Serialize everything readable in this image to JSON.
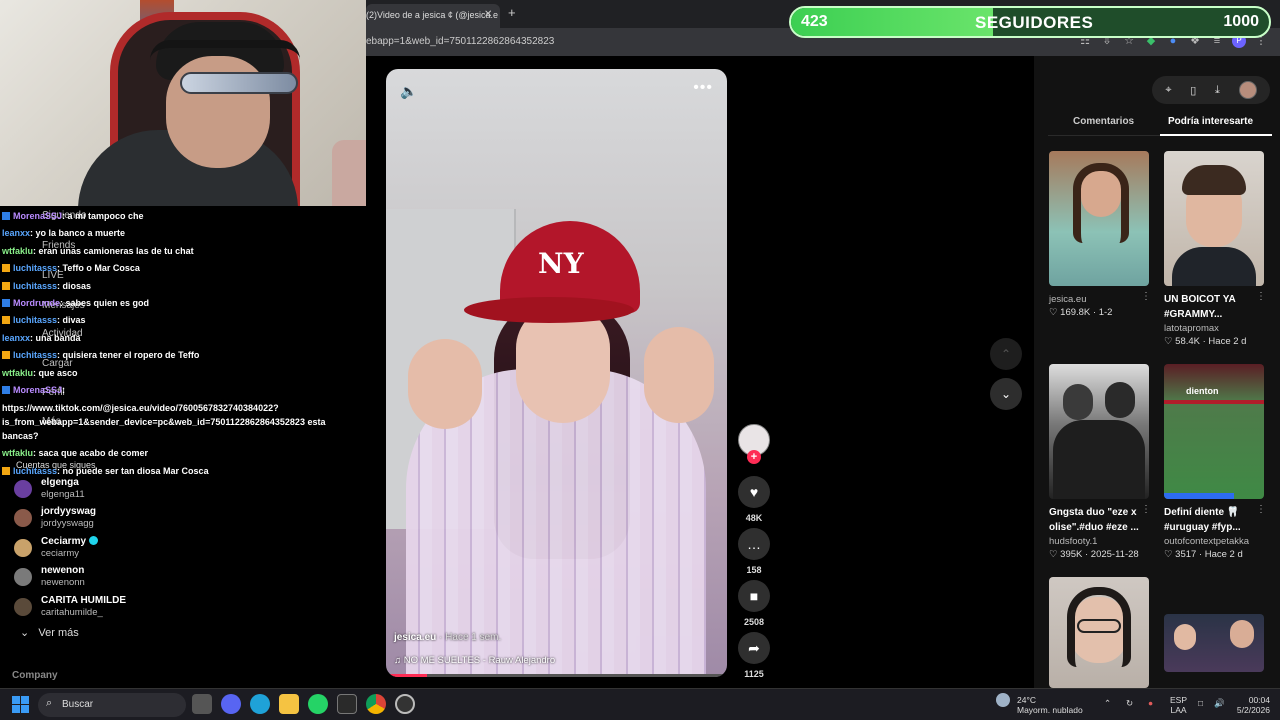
{
  "browser": {
    "tab_title": "(2)Video de a jesica ¢ (@jesica.e",
    "tab_close": "✕",
    "tab_new": "+",
    "url": "ebapp=1&web_id=7501122862864352823"
  },
  "goal": {
    "current": "423",
    "title": "SEGUIDORES",
    "target": "1000",
    "progress_fraction": 0.423
  },
  "chat": [
    {
      "user": "MorenaSSJ",
      "badge": "blue",
      "color": "purple",
      "msg": ": a mi tampoco che"
    },
    {
      "user": "leanxx",
      "badge": "",
      "color": "blue",
      "msg": ": yo la banco a muerte"
    },
    {
      "user": "wtfaklu",
      "badge": "",
      "color": "green",
      "msg": ": eran unas camioneras las de tu chat"
    },
    {
      "user": "luchitasss",
      "badge": "gold",
      "color": "blue",
      "msg": ": Teffo o Mar Cosca"
    },
    {
      "user": "luchitasss",
      "badge": "gold",
      "color": "blue",
      "msg": ": diosas"
    },
    {
      "user": "Mordrunde",
      "badge": "blue",
      "color": "purple",
      "msg": ": sabes quien es god"
    },
    {
      "user": "luchitasss",
      "badge": "gold",
      "color": "blue",
      "msg": ": divas"
    },
    {
      "user": "leanxx",
      "badge": "",
      "color": "blue",
      "msg": ": una banda"
    },
    {
      "user": "luchitasss",
      "badge": "gold",
      "color": "blue",
      "msg": ": quisiera tener el ropero de Teffo"
    },
    {
      "user": "wtfaklu",
      "badge": "",
      "color": "green",
      "msg": ": que asco"
    },
    {
      "user": "MorenaSSJ",
      "badge": "blue",
      "color": "purple",
      "msg": ":"
    },
    {
      "user": "",
      "badge": "",
      "color": "blue",
      "msg": "https://www.tiktok.com/@jesica.eu/video/7600567832740384022?is_from_webapp=1&sender_device=pc&web_id=7501122862864352823 esta bancas?",
      "wrap": true
    },
    {
      "user": "wtfaklu",
      "badge": "",
      "color": "green",
      "msg": ": saca que acabo de comer"
    },
    {
      "user": "luchitasss",
      "badge": "gold",
      "color": "blue",
      "msg": ": no puede ser tan diosa Mar Cosca"
    }
  ],
  "sidebar_ghost": {
    "following": "Siguiendo",
    "friends": "Friends",
    "live": "LIVE",
    "messages": "Mensajes",
    "activity": "Actividad",
    "upload": "Cargar",
    "profile": "Perfil",
    "more": "Más",
    "accounts_title": "Cuentas que sigues"
  },
  "following": [
    {
      "name": "elgenga",
      "handle": "elgenga11",
      "verified": false,
      "color": "#6a3fa0"
    },
    {
      "name": "jordyyswag",
      "handle": "jordyyswagg",
      "verified": false,
      "color": "#8a5a4a"
    },
    {
      "name": "Ceciarmy",
      "handle": "ceciarmy",
      "verified": true,
      "color": "#c9a26a"
    },
    {
      "name": "newenon",
      "handle": "newenonn",
      "verified": false,
      "color": "#7a7a7a"
    },
    {
      "name": "CARITA HUMILDE",
      "handle": "caritahumilde_",
      "verified": false,
      "color": "#5a4a3a"
    }
  ],
  "see_more": "Ver más",
  "company": "Company",
  "video": {
    "author": "jesica.eu",
    "ago": "· Hace 1 sem.",
    "music": "♫  NO ME SUELTES - Rauw Alejandro",
    "logo": "NY",
    "progress_fraction": 0.12
  },
  "actions": {
    "likes": "48K",
    "comments": "158",
    "saves": "2508",
    "shares": "1125"
  },
  "panel": {
    "tab_comments": "Comentarios",
    "tab_interesting": "Podría interesarte"
  },
  "cards": [
    {
      "title": "",
      "title2": "",
      "author": "jesica.eu",
      "stats": "♡ 169.8K  ·  1-2"
    },
    {
      "title": "UN BOICOT YA",
      "title2": "#GRAMMY...",
      "author": "latotapromax",
      "stats": "♡ 58.4K  ·  Hace 2 d"
    },
    {
      "title": "Gngsta duo \"eze x",
      "title2": "olise\".#duo #eze ...",
      "author": "hudsfooty.1",
      "stats": "♡ 395K  ·  2025-11-28"
    },
    {
      "title": "Definí diente 🦷",
      "title2": "#uruguay #fyp...",
      "author": "outofcontextpetakka",
      "stats": "♡ 3517  ·  Hace 2 d"
    }
  ],
  "card_overlay": "dienton",
  "taskbar": {
    "search": "Buscar",
    "temp": "24°C",
    "weather": "Mayorm. nublado",
    "lang1": "ESP",
    "lang2": "LAA",
    "time": "00:04",
    "date": "5/2/2026"
  }
}
